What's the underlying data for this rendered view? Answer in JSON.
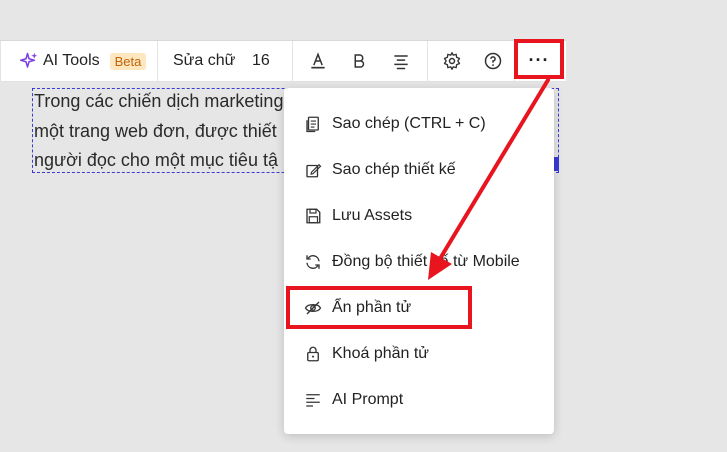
{
  "toolbar": {
    "ai_tools_label": "AI Tools",
    "beta_label": "Beta",
    "edit_text_label": "Sửa chữ",
    "font_size": "16",
    "more_label": "···"
  },
  "content": {
    "line1": "Trong các chiến dịch marketing",
    "line2": "một trang web đơn, được thiết",
    "line3": "người đọc cho một mục tiêu tậ"
  },
  "menu": {
    "items": [
      {
        "label": "Sao chép (CTRL + C)",
        "icon": "copy-icon"
      },
      {
        "label": "Sao chép thiết kế",
        "icon": "copy-design-icon"
      },
      {
        "label": "Lưu Assets",
        "icon": "save-icon"
      },
      {
        "label": "Đồng bộ thiết kế từ Mobile",
        "icon": "sync-icon"
      },
      {
        "label": "Ẩn phần tử",
        "icon": "eye-off-icon"
      },
      {
        "label": "Khoá phần tử",
        "icon": "lock-icon"
      },
      {
        "label": "AI Prompt",
        "icon": "prompt-lines-icon"
      }
    ]
  },
  "colors": {
    "highlight": "#e8141e",
    "selection": "#3a3ad6",
    "ai_icon": "#7b3fe4",
    "beta_bg": "#fde7bf",
    "beta_text": "#c2630a"
  }
}
